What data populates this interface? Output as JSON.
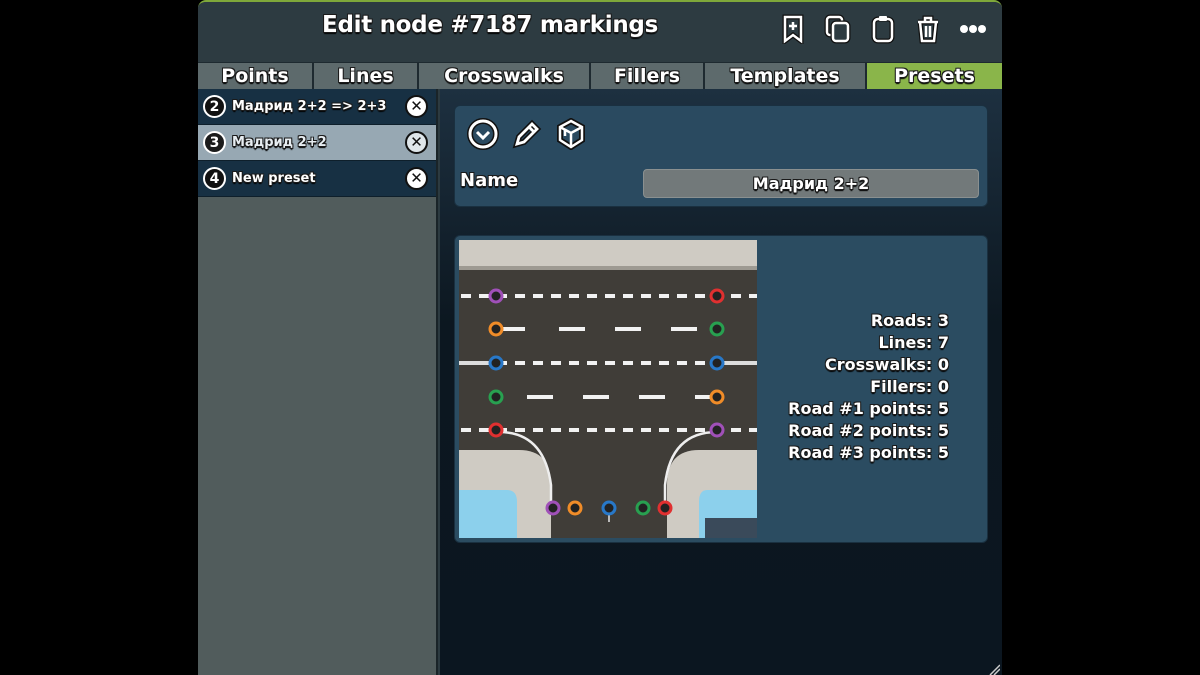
{
  "window": {
    "title": "Edit node #7187 markings",
    "header_icons": [
      {
        "name": "add-bookmark-icon",
        "label": "Save as template"
      },
      {
        "name": "copy-icon",
        "label": "Copy"
      },
      {
        "name": "paste-icon",
        "label": "Paste"
      },
      {
        "name": "trash-icon",
        "label": "Delete all"
      },
      {
        "name": "more-icon",
        "label": "More"
      }
    ]
  },
  "tabs": [
    {
      "label": "Points",
      "active": false
    },
    {
      "label": "Lines",
      "active": false
    },
    {
      "label": "Crosswalks",
      "active": false
    },
    {
      "label": "Fillers",
      "active": false
    },
    {
      "label": "Templates",
      "active": false
    },
    {
      "label": "Presets",
      "active": true
    }
  ],
  "sidebar": {
    "items": [
      {
        "number": "2",
        "label": "Мадрид 2+2 => 2+3",
        "selected": false
      },
      {
        "number": "3",
        "label": "Мадрид 2+2",
        "selected": true
      },
      {
        "number": "4",
        "label": "New preset",
        "selected": false
      }
    ]
  },
  "properties": {
    "toolbar": [
      {
        "name": "apply-icon"
      },
      {
        "name": "edit-pencil-icon"
      },
      {
        "name": "package-icon"
      }
    ],
    "name_label": "Name",
    "name_value": "Мадрид 2+2"
  },
  "preview": {
    "stats": [
      "Roads: 3",
      "Lines: 7",
      "Crosswalks: 0",
      "Fillers: 0",
      "Road #1 points: 5",
      "Road #2 points: 5",
      "Road #3 points: 5"
    ],
    "point_colors": {
      "purple": "#a050b8",
      "red": "#e03030",
      "orange": "#f08c28",
      "green": "#28a050",
      "blue": "#2878c8"
    }
  },
  "colors": {
    "accent": "#8ab54a",
    "tab": "#5d6a6c",
    "selected_item": "#97a8b3"
  }
}
